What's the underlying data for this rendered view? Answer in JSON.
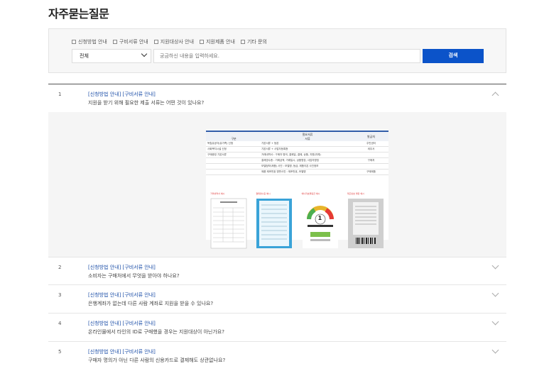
{
  "page": {
    "title": "자주묻는질문"
  },
  "filter": {
    "checkboxes": [
      "신청방법 안내",
      "구비서류 안내",
      "지원대상사 안내",
      "지원제품 안내",
      "기타 문의"
    ],
    "select_value": "전체",
    "search_placeholder": "궁금하신 내용을 입력하세요.",
    "search_button": "검색"
  },
  "faq": [
    {
      "num": "1",
      "cats": "[신청방법 안내] [구비서류 안내]",
      "question": "지원을 받기 위해 필요한 제출 서류는 어떤 것이 있나요?",
      "expanded": true
    },
    {
      "num": "2",
      "cats": "[신청방법 안내] [구비서류 안내]",
      "question": "소비자는 구매처에서 무엇을 받아야 하나요?",
      "expanded": false
    },
    {
      "num": "3",
      "cats": "[신청방법 안내] [구비서류 안내]",
      "question": "은행계좌가 없는데 다른 사람 계좌로 지원을 받을 수 있나요?",
      "expanded": false
    },
    {
      "num": "4",
      "cats": "[신청방법 안내] [구비서류 안내]",
      "question": "온라인몰에서 타인의 ID로 구매했을 경우는 지원대상이 아닌가요?",
      "expanded": false
    },
    {
      "num": "5",
      "cats": "[신청방법 안내] [구비서류 안내]",
      "question": "구매자 명의가 아닌 다른 사람의 신용카드로 결제해도 상관없나요?",
      "expanded": false
    }
  ],
  "answer_doc": {
    "title": "필요서류",
    "col_type": "구분",
    "col_docs": "서류",
    "col_issuer": "발급처",
    "rows": [
      {
        "type": "독립유공자(유가족) 신청",
        "docs": "기본서류 + 등본",
        "issuer": "주민센터"
      },
      {
        "type": "사회복지시설 신청",
        "docs": "기본서류 + 사업자등록증",
        "issuer": "세무서"
      },
      {
        "type": "구매증빙 기본서류",
        "docs": "거래내역서 : 구매자 명의, 결제일, 결제, 상품, 지원(자체)",
        "issuer": ""
      },
      {
        "type": "",
        "docs": "결제영수증 : 거래금액, 거래일시, 상품명칭, 사업자명칭",
        "issuer": "구매처"
      },
      {
        "type": "",
        "docs": "모델정보(제품) 사진 : 모델명, 등급, 제품이온 사진정보",
        "issuer": ""
      },
      {
        "type": "",
        "docs": "제품 제조번호 명판사진 : 제조번호, 모델명",
        "issuer": "구매제품"
      }
    ],
    "thumb_captions": [
      "거래내역서 예시",
      "결제영수증 예시",
      "에너지효율등급 예시",
      "제조번호 명판 예시"
    ],
    "energy_grade": "1"
  },
  "colors": {
    "accent": "#0b53c9",
    "link": "#1d4fa8",
    "header_bar": "#2f5ca8"
  }
}
